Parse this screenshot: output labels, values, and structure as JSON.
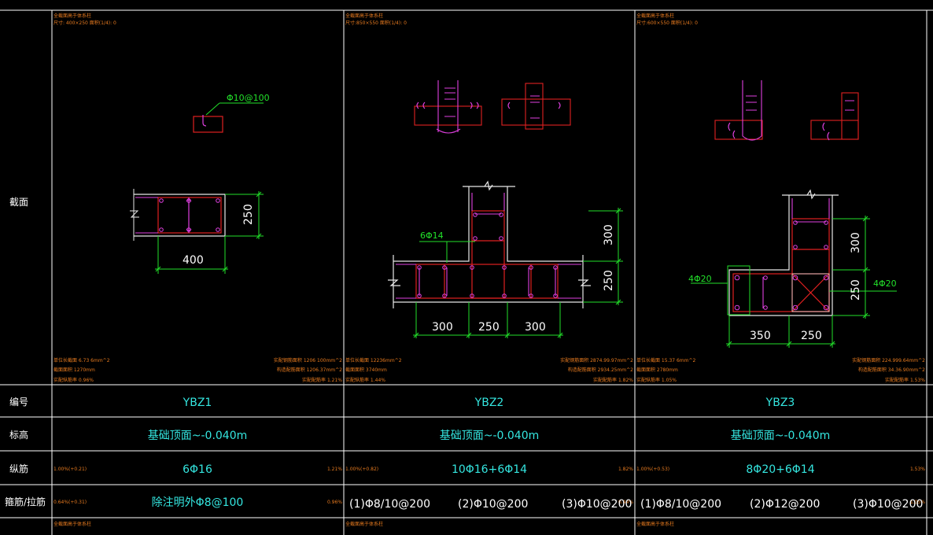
{
  "row_labels": {
    "section": "截面",
    "number": "编号",
    "elevation": "标高",
    "longitudinal": "纵筋",
    "stirrup": "箍筋/拉筋"
  },
  "columns": [
    {
      "id": "YBZ1",
      "elevation": "基础顶面~-0.040m",
      "longitudinal": "6Φ16",
      "stirrup": "除注明外Φ8@100",
      "stirrup_parts": [],
      "corner_notes": {
        "top1": "全截面高于体系柱",
        "top2": "尺寸: 400×250 面积(1/4): 0",
        "bl1": "单位长截面 6.73 6mm^2",
        "bl2": "截面面积 1270mm",
        "bl3": "实配纵筋率 0.96%",
        "br1": "实配钢筋面积 1206 100mm^2",
        "br2": "构造配筋面积 1206.37mm^2",
        "br3": "实配配筋率 1.21%",
        "long_left": "1.00%(+0.21)",
        "long_right": "1.21%",
        "stir_left": "0.64%(+0.31)",
        "stir_right": "0.96%"
      },
      "annotations": {
        "stirrup_label": "Φ10@100",
        "dim_h": "400",
        "dim_v": "250"
      }
    },
    {
      "id": "YBZ2",
      "elevation": "基础顶面~-0.040m",
      "longitudinal": "10Φ16+6Φ14",
      "stirrup": "",
      "stirrup_parts": [
        "(1)Φ8/10@200",
        "(2)Φ10@200",
        "(3)Φ10@200"
      ],
      "corner_notes": {
        "top1": "全截面高于体系柱",
        "top2": "尺寸:850×550 面积(1/4): 0",
        "bl1": "单位长截面 12236mm^2",
        "bl2": "截面面积 3740mm",
        "bl3": "实配纵筋率 1.44%",
        "br1": "实配钢筋面积 2874.99.97mm^2",
        "br2": "构造配筋面积 2934.25mm^2",
        "br3": "实配配筋率 1.82%",
        "long_left": "1.00%(+0.82)",
        "long_right": "1.82%",
        "stir_left": "",
        "stir_right": "0.44%"
      },
      "annotations": {
        "rebar_label": "6Φ14",
        "dim_bottom": [
          "300",
          "250",
          "300"
        ],
        "dim_right": [
          "300",
          "250"
        ]
      }
    },
    {
      "id": "YBZ3",
      "elevation": "基础顶面~-0.040m",
      "longitudinal": "8Φ20+6Φ14",
      "stirrup": "",
      "stirrup_parts": [
        "(1)Φ8/10@200",
        "(2)Φ12@200",
        "(3)Φ10@200"
      ],
      "corner_notes": {
        "top1": "全截面高于体系柱",
        "top2": "尺寸:600×550 面积(1/4): 0",
        "bl1": "单位长截面 15.37 6mm^2",
        "bl2": "截面面积 2780mm",
        "bl3": "实配纵筋率 1.05%",
        "br1": "实配钢筋面积 224.999.64mm^2",
        "br2": "构造配筋面积 34.36.90mm^2",
        "br3": "实配配筋率 1.53%",
        "long_left": "1.00%(+0.53)",
        "long_right": "1.53%",
        "stir_left": "",
        "stir_right": "1.05%"
      },
      "annotations": {
        "rebar_left": "4Φ20",
        "rebar_right": "4Φ20",
        "dim_bottom": [
          "350",
          "250"
        ],
        "dim_right": [
          "300",
          "250"
        ]
      }
    }
  ],
  "colors": {
    "grid": "#ffffff",
    "concrete": "#e8e8e8",
    "rebar": "#e02020",
    "tie": "#e040e0",
    "dimension": "#22e02a",
    "text_cyan": "#34e6e0",
    "note_orange": "#e67a1f"
  }
}
